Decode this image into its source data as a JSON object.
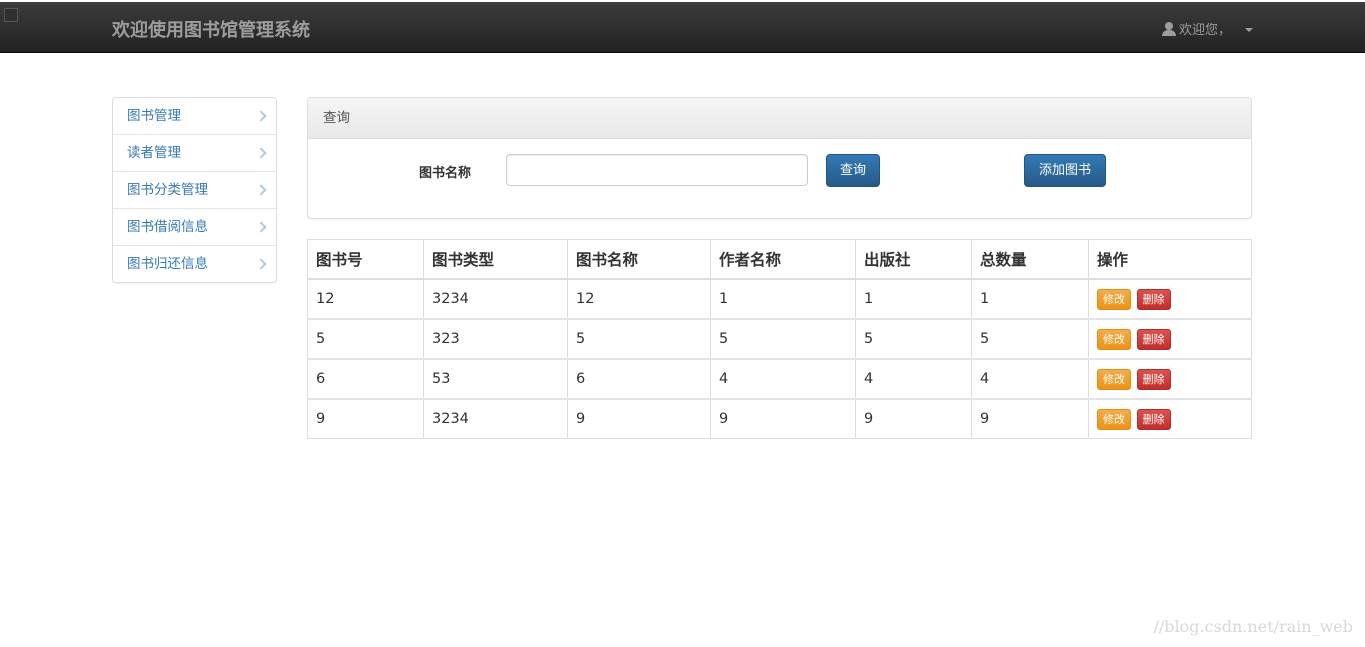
{
  "header": {
    "brand": "欢迎使用图书馆管理系统",
    "user_label": "欢迎您，"
  },
  "sidebar": {
    "items": [
      {
        "label": "图书管理"
      },
      {
        "label": "读者管理"
      },
      {
        "label": "图书分类管理"
      },
      {
        "label": "图书借阅信息"
      },
      {
        "label": "图书归还信息"
      }
    ]
  },
  "query": {
    "panel_title": "查询",
    "field_label": "图书名称",
    "field_value": "",
    "field_placeholder": "",
    "search_button": "查询",
    "add_button": "添加图书"
  },
  "table": {
    "columns": [
      "图书号",
      "图书类型",
      "图书名称",
      "作者名称",
      "出版社",
      "总数量",
      "操作"
    ],
    "rows": [
      [
        "12",
        "3234",
        "12",
        "1",
        "1",
        "1"
      ],
      [
        "5",
        "323",
        "5",
        "5",
        "5",
        "5"
      ],
      [
        "6",
        "53",
        "6",
        "4",
        "4",
        "4"
      ],
      [
        "9",
        "3234",
        "9",
        "9",
        "9",
        "9"
      ]
    ],
    "edit_label": "修改",
    "delete_label": "删除"
  },
  "watermark": "//blog.csdn.net/rain_web",
  "colors": {
    "navbar": "#222222",
    "primary": "#337ab7",
    "warning": "#f0ad4e",
    "danger": "#d9534f",
    "link": "#337ab7"
  }
}
